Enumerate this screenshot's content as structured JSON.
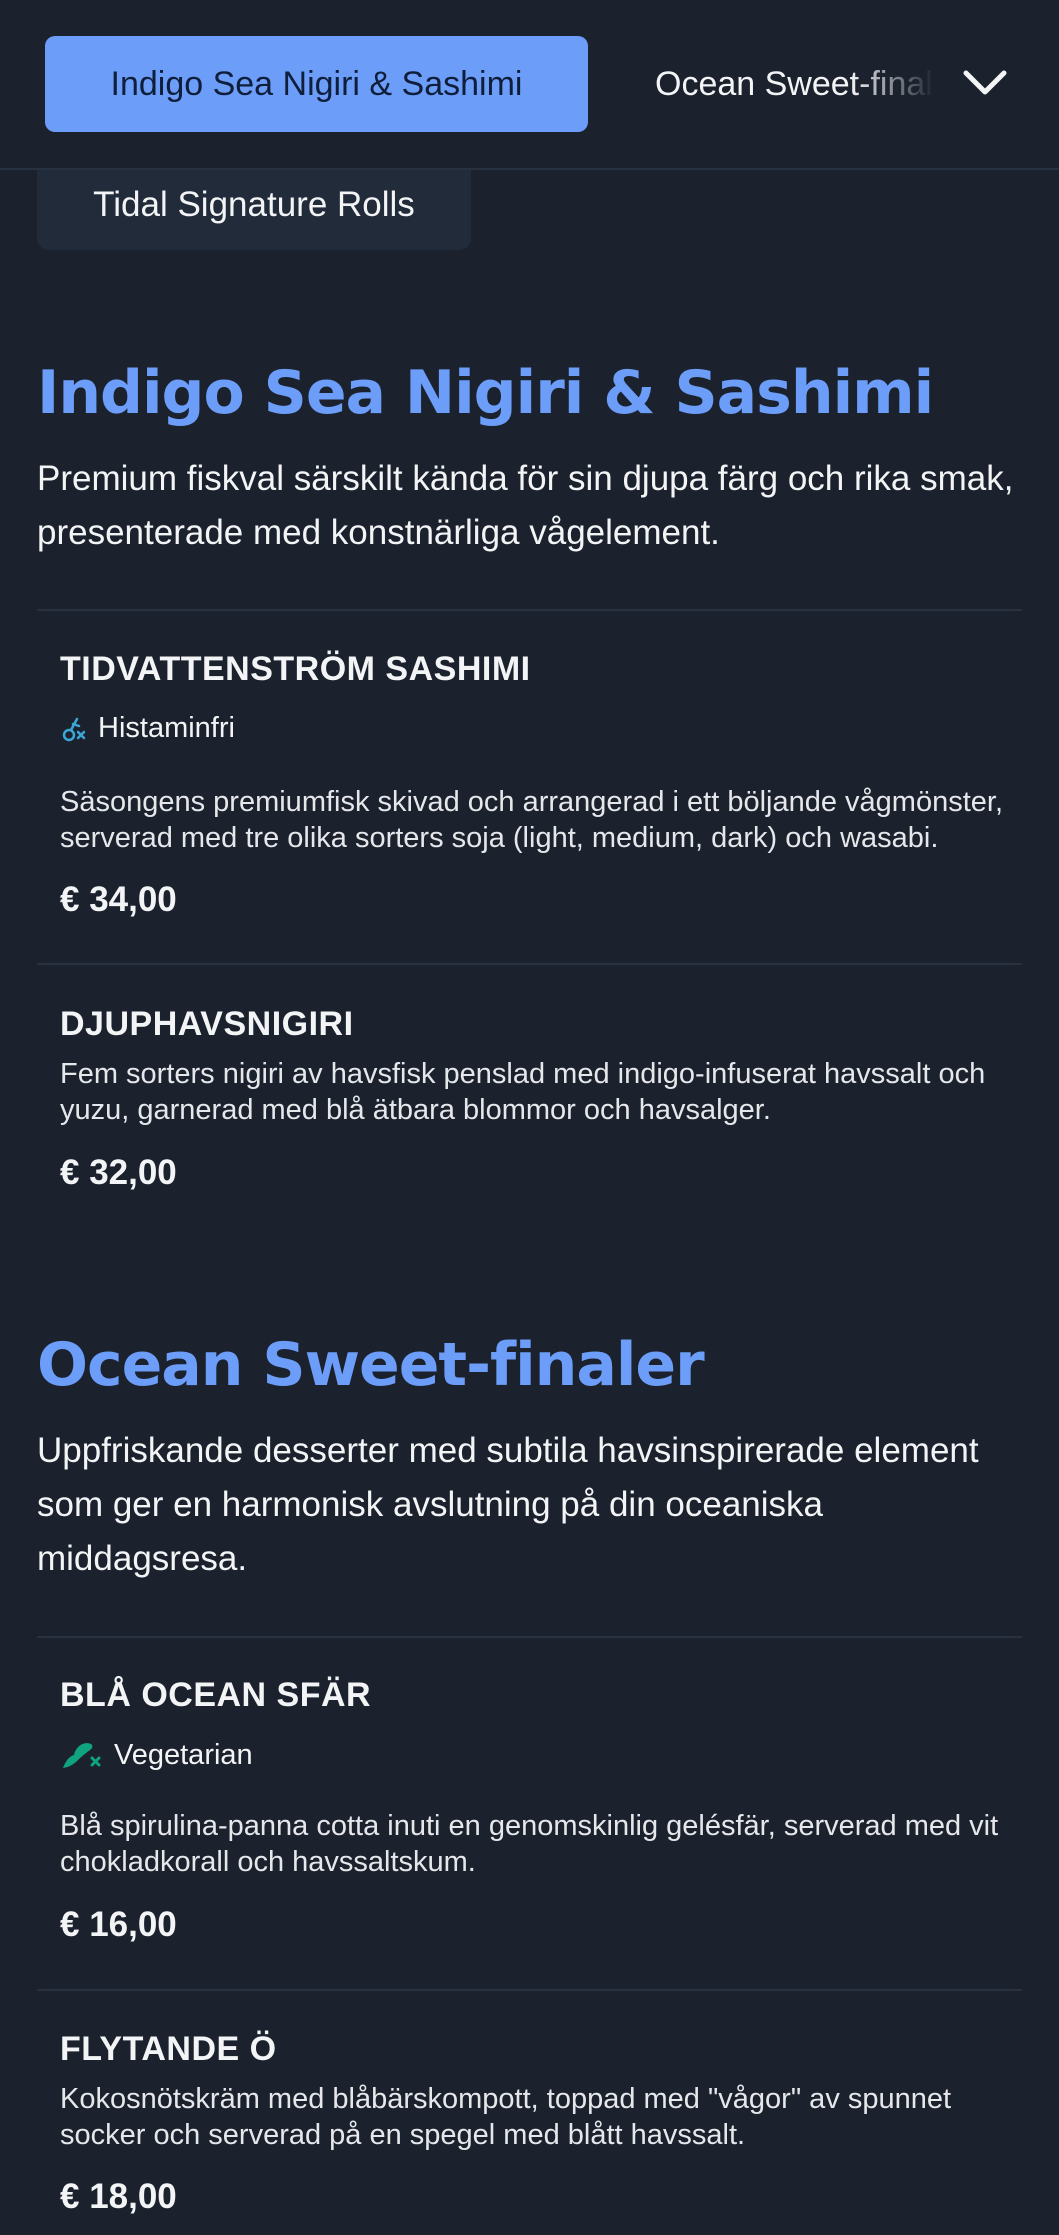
{
  "nav": {
    "active_category": "Indigo Sea Nigiri & Sashimi",
    "next_category": "Ocean Sweet-finaler",
    "prev_category": "Tidal Signature Rolls",
    "expand_icon": "chevron-down-icon"
  },
  "sections": [
    {
      "title": "Indigo Sea Nigiri & Sashimi",
      "description": "Premium fiskval särskilt kända för sin djupa färg och rika smak, presenterade med konstnärliga vågelement.",
      "items": [
        {
          "name": "TIDVATTENSTRÖM SASHIMI",
          "tag": "Histaminfri",
          "tag_icon": "histamine-free-icon",
          "description": "Säsongens premiumfisk skivad och arrangerad i ett böljande vågmönster, serverad med tre olika sorters soja (light, medium, dark) och wasabi.",
          "price": "€ 34,00"
        },
        {
          "name": "DJUPHAVSNIGIRI",
          "description": "Fem sorters nigiri av havsfisk penslad med indigo-infuserat havssalt och yuzu, garnerad med blå ätbara blommor och havsalger.",
          "price": "€ 32,00"
        }
      ]
    },
    {
      "title": "Ocean Sweet-finaler",
      "description": "Uppfriskande desserter med subtila havsinspirerade element som ger en harmonisk avslutning på din oceaniska middagsresa.",
      "items": [
        {
          "name": "BLÅ OCEAN SFÄR",
          "tag": "Vegetarian",
          "tag_icon": "vegetarian-icon",
          "description": "Blå spirulina-panna cotta inuti en genomskinlig gelésfär, serverad med vit chokladkorall och havssaltskum.",
          "price": "€ 16,00"
        },
        {
          "name": "FLYTANDE Ö",
          "description": "Kokosnötskräm med blåbärskompott, toppad med \"vågor\" av spunnet socker och serverad på en spegel med blått havssalt.",
          "price": "€ 18,00"
        }
      ]
    }
  ],
  "colors": {
    "background": "#1b222d",
    "accent": "#6c9df8",
    "histamine_icon": "#3aa7d6",
    "vegetarian_icon": "#10a37f"
  }
}
